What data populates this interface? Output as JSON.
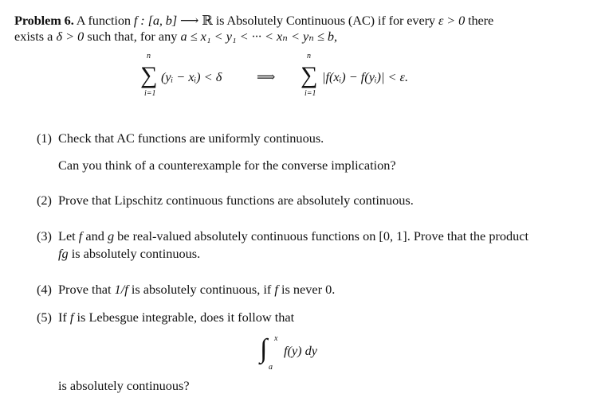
{
  "lines": {
    "p1": [
      {
        "t": "Problem 6.",
        "s": "b"
      },
      {
        "t": " A function "
      },
      {
        "t": "f : [a, b] ⟶ ",
        "s": "m"
      },
      {
        "t": "ℝ"
      },
      {
        "t": " is Absolutely Continuous (AC) if for every "
      },
      {
        "t": "ε > 0",
        "s": "m"
      },
      {
        "t": " there"
      }
    ],
    "p2": [
      {
        "t": "exists a "
      },
      {
        "t": "δ > 0",
        "s": "m"
      },
      {
        "t": " such that, for any "
      },
      {
        "t": "a ≤ x₁ < y₁ < ··· < xₙ < yₙ ≤ b",
        "s": "m"
      },
      {
        "t": ","
      }
    ],
    "d1": [
      {
        "t": "(yᵢ − xᵢ) < δ",
        "s": "m"
      }
    ],
    "d2": [
      {
        "t": "⟹"
      }
    ],
    "d3": [
      {
        "t": "|f(xᵢ) − f(yᵢ)| < ε.",
        "s": "m"
      }
    ],
    "i1a": [
      {
        "t": "(1)"
      }
    ],
    "i1b": [
      {
        "t": "Check that AC functions are uniformly continuous."
      }
    ],
    "i1c": [
      {
        "t": "Can you think of a counterexample for the converse implication?"
      }
    ],
    "i2a": [
      {
        "t": "(2)"
      }
    ],
    "i2b": [
      {
        "t": "Prove that Lipschitz continuous functions are absolutely continuous."
      }
    ],
    "i3a": [
      {
        "t": "(3)"
      }
    ],
    "i3b": [
      {
        "t": "Let "
      },
      {
        "t": "f",
        "s": "m"
      },
      {
        "t": " and "
      },
      {
        "t": "g",
        "s": "m"
      },
      {
        "t": " be real-valued absolutely continuous functions on "
      },
      {
        "t": "[0, 1]"
      },
      {
        "t": ". Prove that the product"
      }
    ],
    "i3c": [
      {
        "t": "fg",
        "s": "m"
      },
      {
        "t": " is absolutely continuous."
      }
    ],
    "i4a": [
      {
        "t": "(4)"
      }
    ],
    "i4b": [
      {
        "t": "Prove that "
      },
      {
        "t": "1/f",
        "s": "m"
      },
      {
        "t": " is absolutely continuous, if "
      },
      {
        "t": "f",
        "s": "m"
      },
      {
        "t": " is never "
      },
      {
        "t": "0"
      },
      {
        "t": "."
      }
    ],
    "i5a": [
      {
        "t": "(5)"
      }
    ],
    "i5b": [
      {
        "t": "If "
      },
      {
        "t": "f",
        "s": "m"
      },
      {
        "t": " is Lebesgue integrable, does it follow that"
      }
    ],
    "int": [
      {
        "t": "f(y) dy",
        "s": "m"
      }
    ],
    "i5c": [
      {
        "t": "is absolutely continuous?"
      }
    ]
  },
  "display": {
    "sum": "∑",
    "upper": "n",
    "lower": "i=1"
  },
  "integral": {
    "sign": "∫",
    "upper": "x",
    "lower": "a"
  }
}
